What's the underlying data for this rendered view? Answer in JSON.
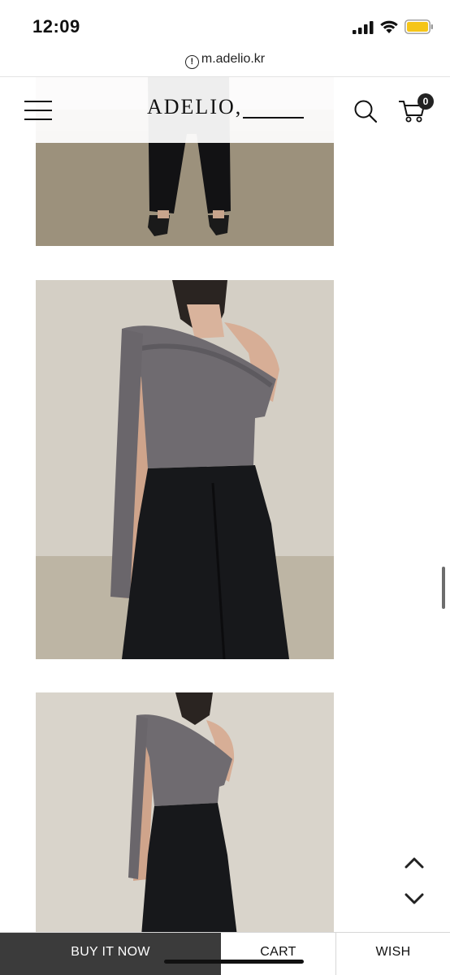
{
  "status_bar": {
    "time": "12:09",
    "icons": [
      "signal-icon",
      "wifi-icon",
      "battery-icon"
    ],
    "battery_color": "#f5c518"
  },
  "browser": {
    "url": "m.adelio.kr",
    "url_icon": "info-icon"
  },
  "header": {
    "menu_icon": "menu-icon",
    "logo": "ADELIO,",
    "search_icon": "search-icon",
    "cart_icon": "cart-icon",
    "cart_count": "0"
  },
  "product_images": [
    {
      "name": "product-photo-1",
      "alt": "black wide trousers"
    },
    {
      "name": "product-photo-2",
      "alt": "grey one-shoulder drape top"
    },
    {
      "name": "product-photo-3",
      "alt": "grey one-shoulder drape top"
    }
  ],
  "floating_nav": {
    "up_icon": "chevron-up-icon",
    "down_icon": "chevron-down-icon"
  },
  "bottom_bar": {
    "buy_label": "BUY IT NOW",
    "cart_label": "CART",
    "wish_label": "WISH",
    "buy_bg": "#3b3b3b"
  }
}
